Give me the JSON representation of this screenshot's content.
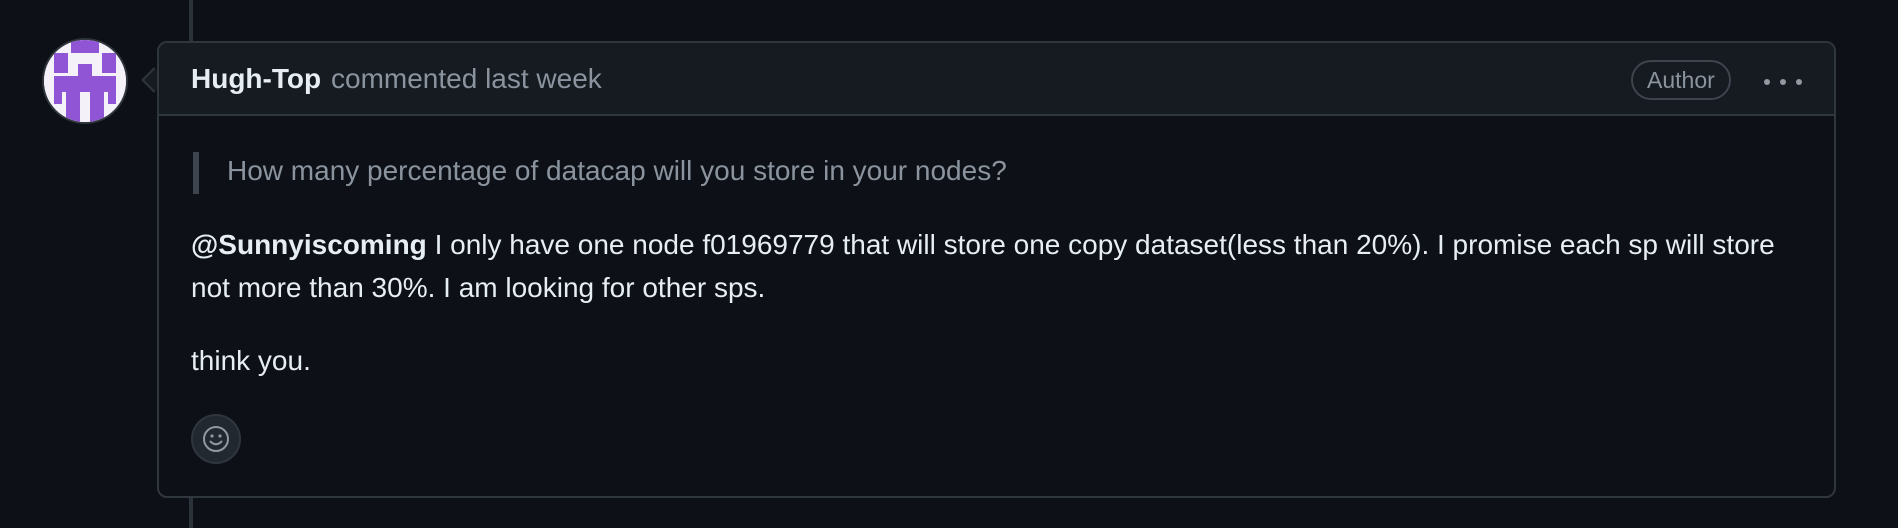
{
  "comment": {
    "author": "Hugh-Top",
    "meta": "commented last week",
    "badge": "Author",
    "quote": "How many percentage of datacap will you store in your nodes?",
    "mention": "@Sunnyiscoming",
    "body_line": "I only have one node f01969779 that will store one copy dataset(less than 20%). I promise each sp will store not more than 30%. I am looking for other sps.",
    "body_line2": "think you."
  },
  "icons": {
    "menu": "kebab-horizontal-icon",
    "reaction": "smiley-icon",
    "avatar": "identicon"
  },
  "colors": {
    "background": "#0d1117",
    "header_bg": "#161b22",
    "border": "#30363d",
    "text": "#e6edf3",
    "muted": "#8b949e",
    "identicon": "#8f55d4"
  }
}
